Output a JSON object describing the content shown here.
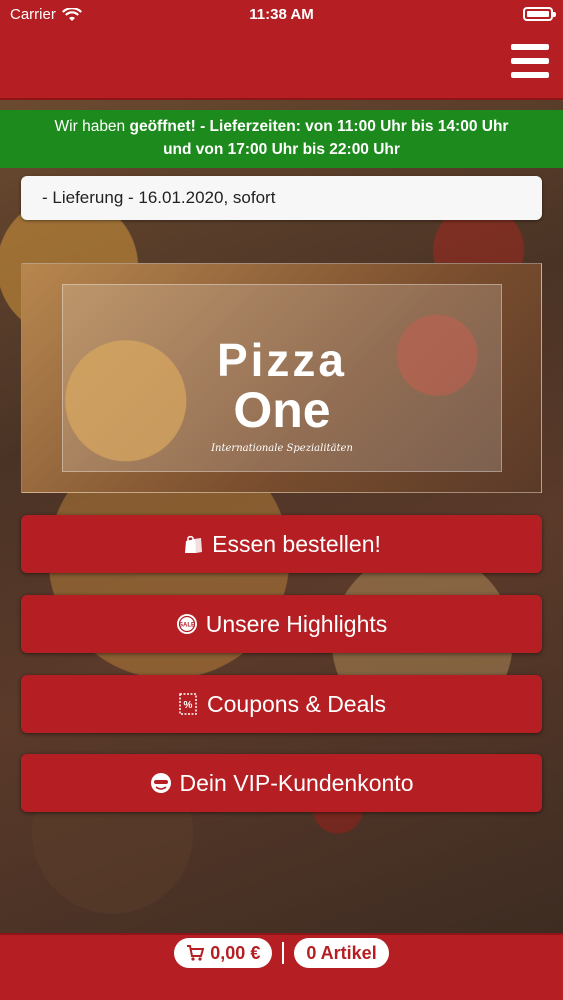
{
  "status_bar": {
    "carrier": "Carrier",
    "time": "11:38 AM"
  },
  "open_notice": {
    "part1": "Wir haben ",
    "bold1": "geöffnet!",
    "part2": " - Lieferzeiten: von 11:00 Uhr bis 14:00 Uhr",
    "line2": "und von 17:00 Uhr bis 22:00 Uhr"
  },
  "delivery": {
    "label": "- Lieferung - 16.01.2020, sofort"
  },
  "logo": {
    "line1": "Pizza",
    "line2": "One",
    "tagline": "Internationale Spezialitäten"
  },
  "buttons": {
    "order": "Essen bestellen!",
    "highlights": "Unsere Highlights",
    "coupons": "Coupons & Deals",
    "vip": "Dein VIP-Kundenkonto"
  },
  "cart": {
    "total": "0,00 €",
    "items": "0 Artikel"
  },
  "colors": {
    "brand_red": "#b51f23",
    "open_green": "#1d8a1d"
  },
  "icons": [
    "wifi-icon",
    "battery-icon",
    "menu-icon",
    "shopping-bag-icon",
    "sale-badge-icon",
    "coupon-icon",
    "vip-icon",
    "cart-icon"
  ]
}
